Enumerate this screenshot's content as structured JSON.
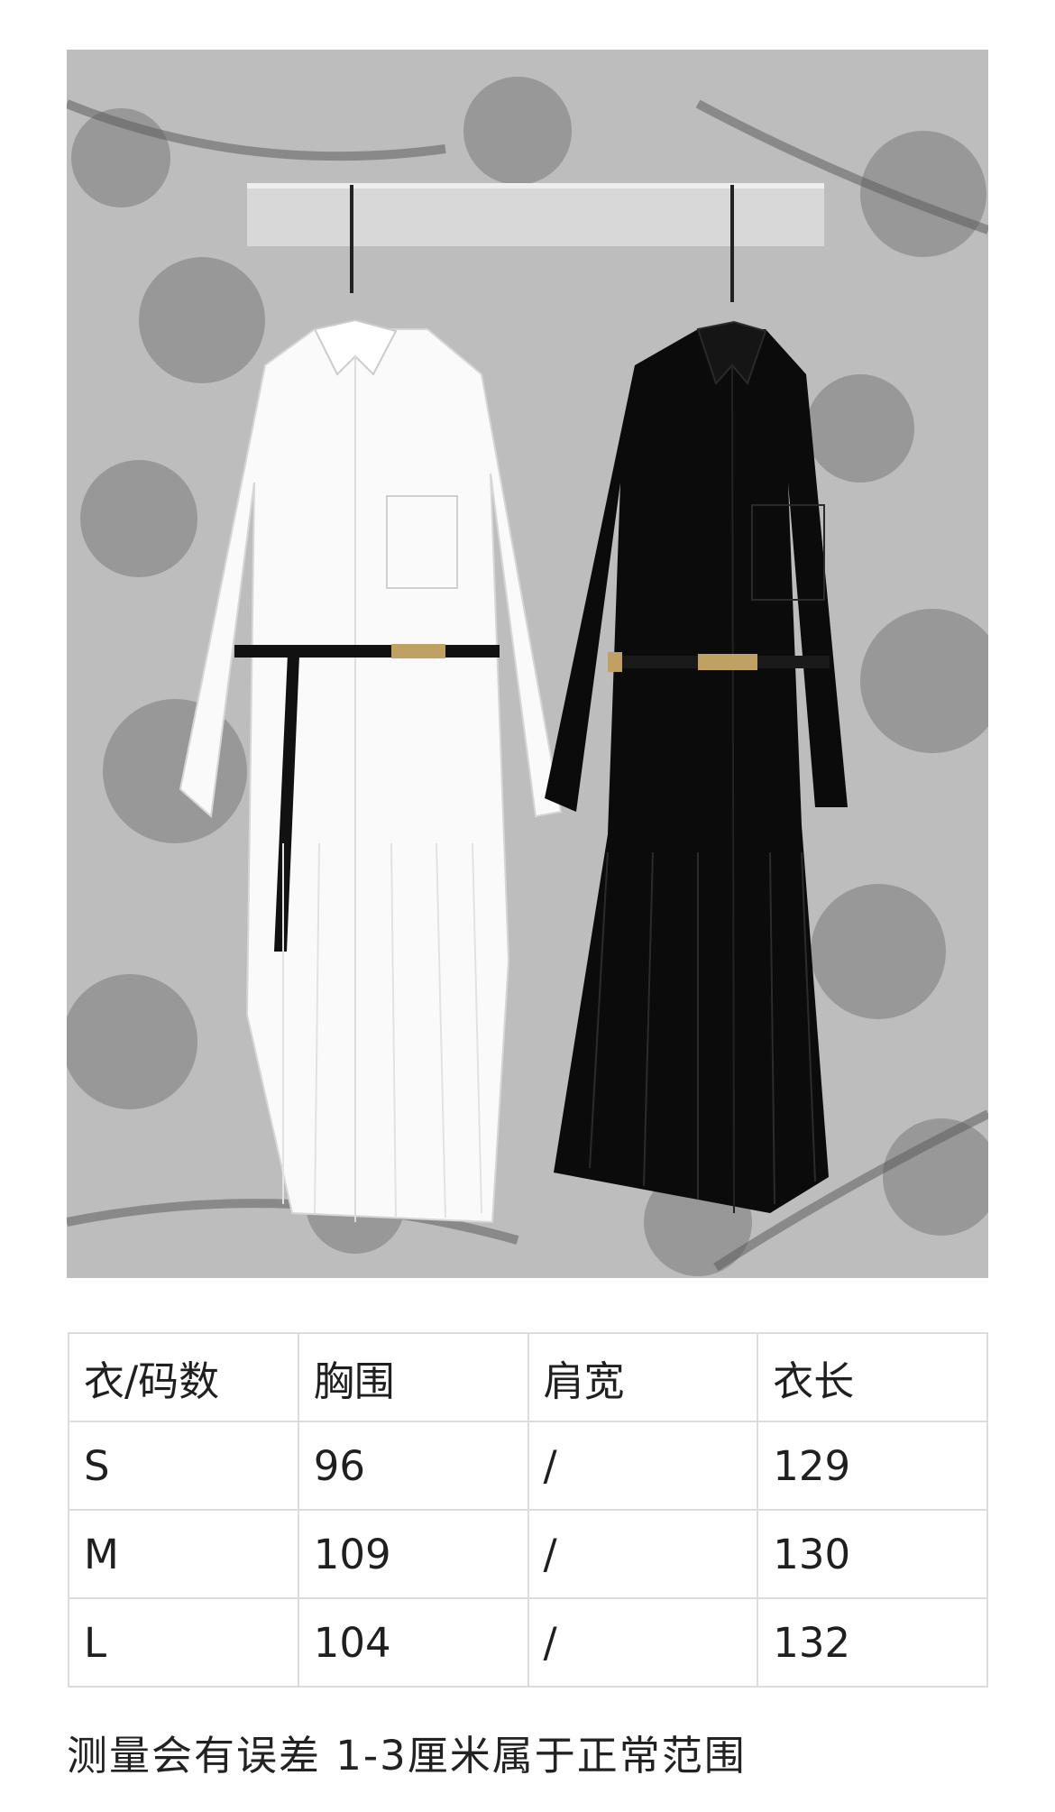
{
  "photo": {
    "alt": "",
    "background_color": "#b9b9b9",
    "dress_colors": [
      "#fafafa",
      "#0b0b0b"
    ]
  },
  "size_table": {
    "headers": [
      "衣/码数",
      "胸围",
      "肩宽",
      "衣长"
    ],
    "rows": [
      [
        "S",
        "96",
        "/",
        "129"
      ],
      [
        "M",
        "109",
        "/",
        "130"
      ],
      [
        "L",
        "104",
        "/",
        "132"
      ]
    ]
  },
  "note": "测量会有误差 1-3厘米属于正常范围"
}
